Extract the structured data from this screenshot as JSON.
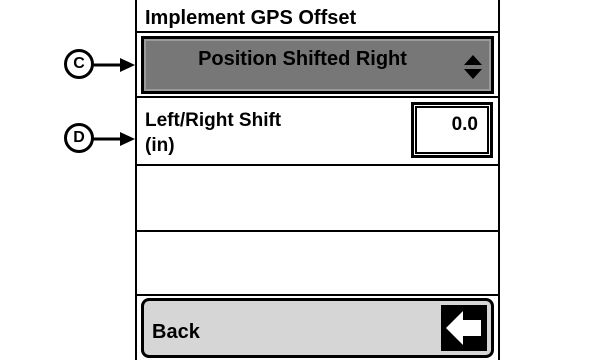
{
  "screen": {
    "title": "Implement GPS Offset"
  },
  "dropdown": {
    "selected_value": "Position Shifted Right",
    "icon": "up-down-arrows-icon"
  },
  "field": {
    "label_line1": "Left/Right Shift",
    "label_line2": "(in)",
    "value": "0.0"
  },
  "back_button": {
    "label": "Back",
    "icon": "left-arrow-icon"
  },
  "callouts": {
    "c": "C",
    "d": "D"
  }
}
